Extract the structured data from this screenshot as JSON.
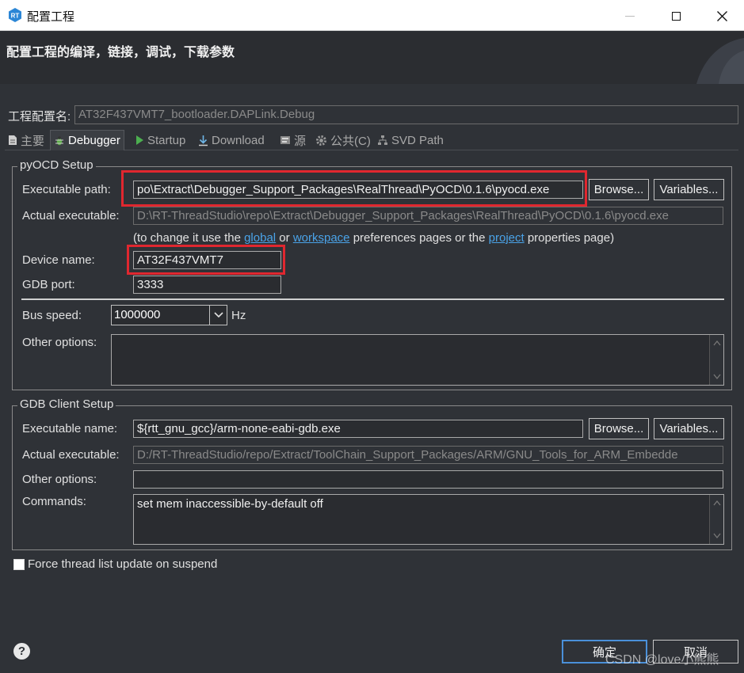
{
  "window": {
    "title": "配置工程",
    "minimize_glyph": "—",
    "maximize_glyph": "☐",
    "close_glyph": "✕"
  },
  "header": {
    "description": "配置工程的编译，链接，调试，下载参数"
  },
  "config_name": {
    "label": "工程配置名:",
    "value": "AT32F437VMT7_bootloader.DAPLink.Debug"
  },
  "tabs": [
    {
      "label": "主要",
      "icon": "file-icon",
      "active": false
    },
    {
      "label": "Debugger",
      "icon": "bug-icon",
      "active": true
    },
    {
      "label": "Startup",
      "icon": "play-icon",
      "active": false
    },
    {
      "label": "Download",
      "icon": "download-icon",
      "active": false
    },
    {
      "label": "源",
      "icon": "source-icon",
      "active": false
    },
    {
      "label": "公共(C)",
      "icon": "gear-icon",
      "active": false
    },
    {
      "label": "SVD Path",
      "icon": "tree-icon",
      "active": false
    }
  ],
  "pyocd": {
    "group_title": "pyOCD Setup",
    "exe_path_label": "Executable path:",
    "exe_path_value": "po\\Extract\\Debugger_Support_Packages\\RealThread\\PyOCD\\0.1.6\\pyocd.exe",
    "browse_label": "Browse...",
    "variables_label": "Variables...",
    "actual_exe_label": "Actual executable:",
    "actual_exe_value": "D:\\RT-ThreadStudio\\repo\\Extract\\Debugger_Support_Packages\\RealThread\\PyOCD\\0.1.6\\pyocd.exe",
    "hint_prefix": "(to change it use the ",
    "hint_global": "global",
    "hint_or": " or ",
    "hint_workspace": "workspace",
    "hint_middle": " preferences pages or the ",
    "hint_project": "project",
    "hint_suffix": " properties page)",
    "device_name_label": "Device name:",
    "device_name_value": "AT32F437VMT7",
    "gdb_port_label": "GDB port:",
    "gdb_port_value": "3333",
    "bus_speed_label": "Bus speed:",
    "bus_speed_value": "1000000",
    "bus_speed_unit": "Hz",
    "other_options_label": "Other options:",
    "other_options_value": ""
  },
  "gdb_client": {
    "group_title": "GDB Client Setup",
    "exe_name_label": "Executable name:",
    "exe_name_value": "${rtt_gnu_gcc}/arm-none-eabi-gdb.exe",
    "browse_label": "Browse...",
    "variables_label": "Variables...",
    "actual_exe_label": "Actual executable:",
    "actual_exe_value": "D:/RT-ThreadStudio/repo/Extract/ToolChain_Support_Packages/ARM/GNU_Tools_for_ARM_Embedde",
    "other_options_label": "Other options:",
    "other_options_value": "",
    "commands_label": "Commands:",
    "commands_value": "set mem inaccessible-by-default off"
  },
  "force_thread": {
    "label": "Force thread list update on suspend",
    "checked": false
  },
  "footer": {
    "help_glyph": "?",
    "ok_label": "确定",
    "cancel_label": "取消"
  },
  "watermark": "CSDN @love小熊熊",
  "colors": {
    "background": "#2f3237",
    "highlight_box": "#e0272f",
    "link": "#4aa3e8"
  }
}
